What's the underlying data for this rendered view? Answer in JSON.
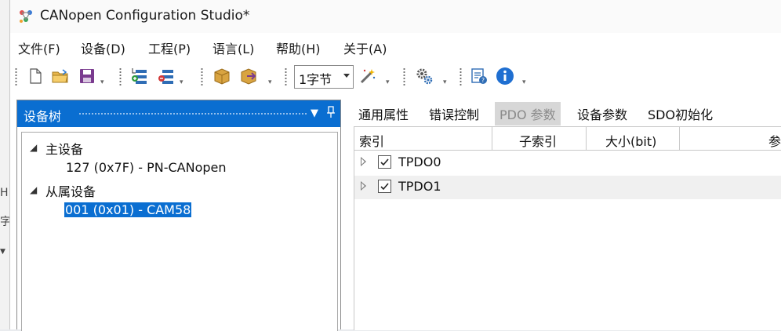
{
  "window": {
    "title": "CANopen Configuration Studio*"
  },
  "left_fragments": [
    "H",
    "字"
  ],
  "menu": [
    "文件(F)",
    "设备(D)",
    "工程(P)",
    "语言(L)",
    "帮助(H)",
    "关于(A)"
  ],
  "toolbar": {
    "byte_select": "1字节"
  },
  "device_tree": {
    "title": "设备树",
    "master_label": "主设备",
    "master_node": "127 (0x7F)  -  PN-CANopen",
    "slave_label": "从属设备",
    "slave_node": "001 (0x01)  -  CAM58"
  },
  "tabs": [
    "通用属性",
    "错误控制",
    "PDO 参数",
    "设备参数",
    "SDO初始化"
  ],
  "active_tab": "PDO 参数",
  "grid": {
    "columns": [
      "索引",
      "子索引",
      "大小(bit)",
      "参"
    ],
    "rows": [
      {
        "name": "TPDO0",
        "checked": true
      },
      {
        "name": "TPDO1",
        "checked": true
      }
    ]
  },
  "colors": {
    "accent": "#0a6ed1",
    "selection": "#0a6ed1",
    "tab_active_bg": "#d7d7d7"
  }
}
